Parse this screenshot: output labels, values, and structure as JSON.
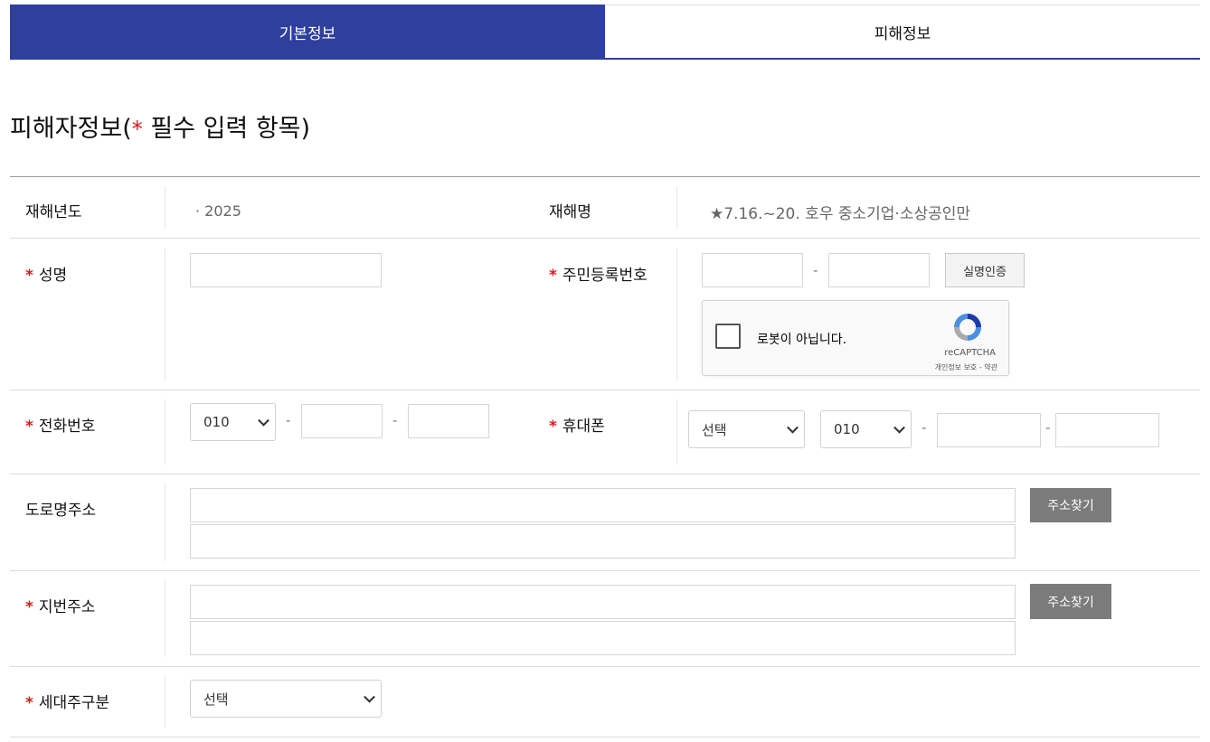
{
  "tabs": {
    "basic": "기본정보",
    "damage": "피해정보"
  },
  "section": {
    "title_prefix": "피해자정보(",
    "required_star": "*",
    "title_suffix": " 필수 입력 항목)"
  },
  "star": "*",
  "fields": {
    "disaster_year": {
      "label": "재해년도",
      "value": "· 2025"
    },
    "disaster_name": {
      "label": "재해명",
      "value": "★7.16.~20. 호우 중소기업·소상공인만"
    },
    "name": {
      "label": "성명",
      "value": ""
    },
    "rrn": {
      "label": "주민등록번호",
      "dash": "-",
      "verify_button": "실명인증"
    },
    "captcha": {
      "text": "로봇이 아닙니다.",
      "brand": "reCAPTCHA",
      "terms": "개인정보 보호 - 약관"
    },
    "phone": {
      "label": "전화번호",
      "prefix": "010",
      "dash": "-"
    },
    "mobile": {
      "label": "휴대폰",
      "carrier": "선택",
      "prefix": "010",
      "dash": "-"
    },
    "road_address": {
      "label": "도로명주소",
      "search_button": "주소찾기"
    },
    "lot_address": {
      "label": "지번주소",
      "search_button": "주소찾기"
    },
    "household": {
      "label": "세대주구분",
      "selected": "선택"
    }
  },
  "colors": {
    "primary": "#2f3f9e",
    "required": "#e0151b",
    "dark_button": "#7b7b7b"
  }
}
